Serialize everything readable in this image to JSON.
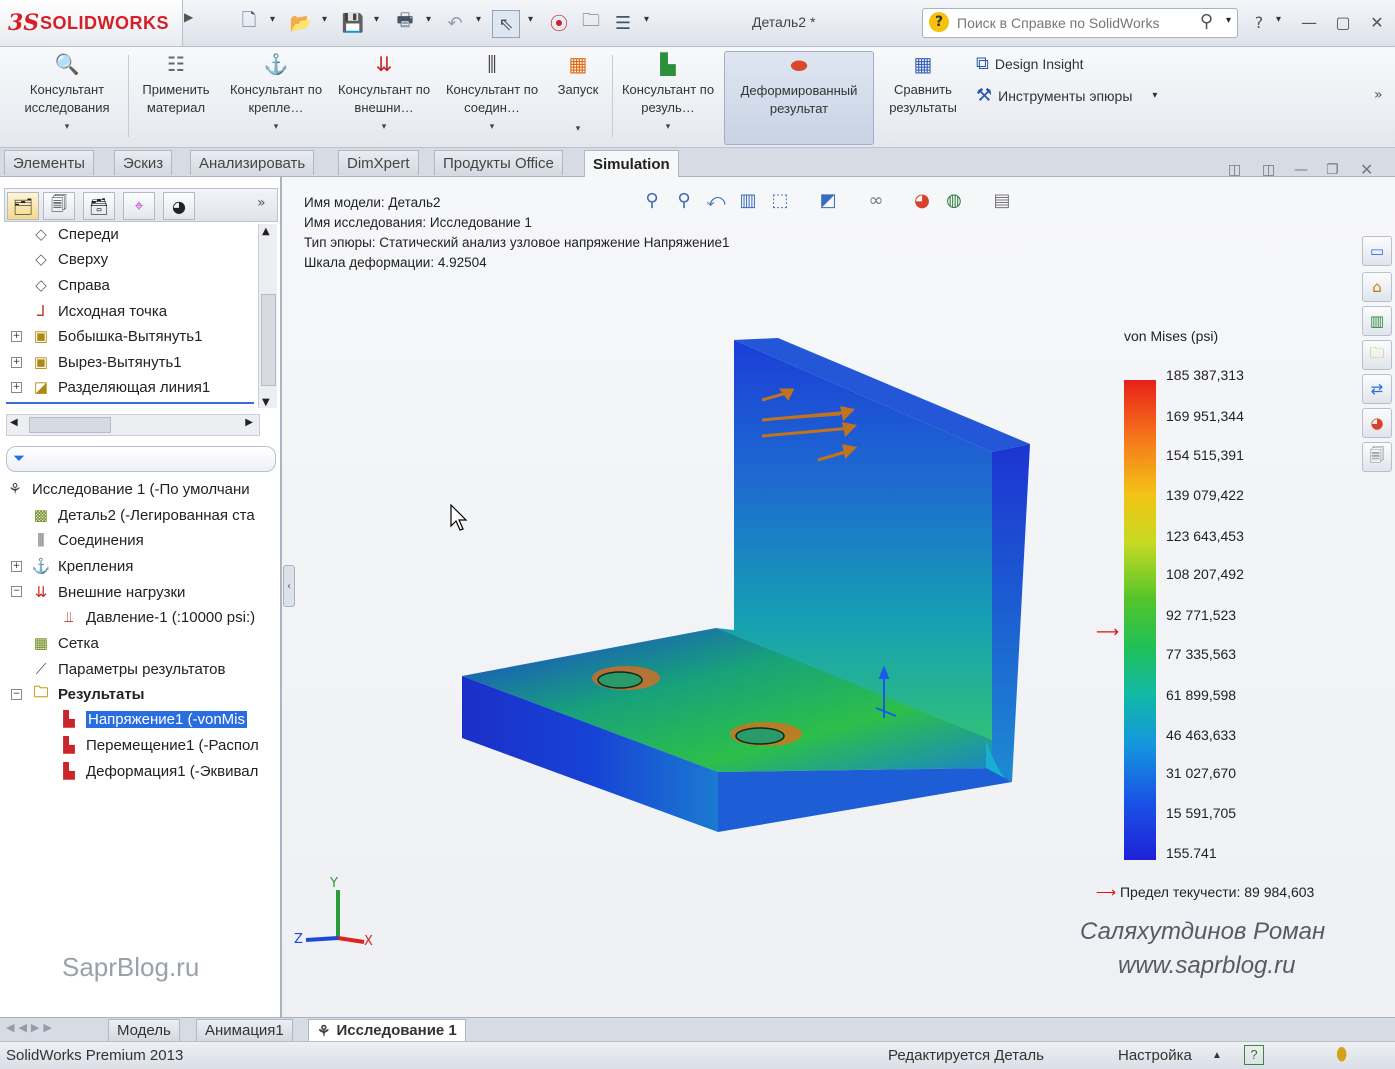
{
  "app": {
    "logo_ds": "3S",
    "logo_text": "SOLIDWORKS",
    "document_title": "Деталь2 *",
    "search_placeholder": "Поиск в Справке по SolidWorks"
  },
  "ribbon": {
    "buttons": [
      {
        "label": "Консультант исследования",
        "icon": "study-advisor-icon"
      },
      {
        "label": "Применить материал",
        "icon": "apply-material-icon"
      },
      {
        "label": "Консультант по крепле…",
        "icon": "fixtures-advisor-icon"
      },
      {
        "label": "Консультант по внешни…",
        "icon": "loads-advisor-icon"
      },
      {
        "label": "Консультант по соедин…",
        "icon": "connections-advisor-icon"
      },
      {
        "label": "Запуск",
        "icon": "run-icon"
      },
      {
        "label": "Консультант по резуль…",
        "icon": "results-advisor-icon"
      },
      {
        "label": "Деформированный результат",
        "icon": "deformed-result-icon"
      },
      {
        "label": "Сравнить результаты",
        "icon": "compare-results-icon"
      }
    ],
    "design_insight": "Design Insight",
    "plot_tools": "Инструменты эпюры"
  },
  "tabs": [
    "Элементы",
    "Эскиз",
    "Анализировать",
    "DimXpert",
    "Продукты Office",
    "Simulation"
  ],
  "feature_tree": [
    {
      "label": "Спереди",
      "icon": "plane-icon"
    },
    {
      "label": "Сверху",
      "icon": "plane-icon"
    },
    {
      "label": "Справа",
      "icon": "plane-icon"
    },
    {
      "label": "Исходная точка",
      "icon": "origin-icon"
    },
    {
      "label": "Бобышка-Вытянуть1",
      "icon": "extrude-boss-icon"
    },
    {
      "label": "Вырез-Вытянуть1",
      "icon": "extrude-cut-icon"
    },
    {
      "label": "Разделяющая линия1",
      "icon": "split-line-icon"
    }
  ],
  "study_tree": [
    {
      "label": "Исследование 1 (-По умолчани",
      "icon": "study-icon"
    },
    {
      "label": "Деталь2 (-Легированная ста",
      "icon": "part-icon"
    },
    {
      "label": "Соединения",
      "icon": "connections-icon"
    },
    {
      "label": "Крепления",
      "icon": "fixtures-icon"
    },
    {
      "label": "Внешние нагрузки",
      "icon": "external-loads-icon"
    },
    {
      "label": "Давление-1 (:10000 psi:)",
      "icon": "pressure-icon"
    },
    {
      "label": "Сетка",
      "icon": "mesh-icon"
    },
    {
      "label": "Параметры результатов",
      "icon": "result-options-icon"
    },
    {
      "label": "Результаты",
      "icon": "results-folder-icon"
    },
    {
      "label": "Напряжение1 (-vonMis",
      "icon": "stress-plot-icon"
    },
    {
      "label": "Перемещение1 (-Распол",
      "icon": "displacement-plot-icon"
    },
    {
      "label": "Деформация1 (-Эквивал",
      "icon": "strain-plot-icon"
    }
  ],
  "viewport": {
    "info": [
      "Имя модели: Деталь2",
      "Имя исследования: Исследование 1",
      "Тип эпюры: Статический анализ узловое напряжение Напряжение1",
      "Шкала деформации: 4.92504"
    ],
    "legend_title": "von Mises (psi)",
    "legend_ticks": [
      "185 387,313",
      "169 951,344",
      "154 515,391",
      "139 079,422",
      "123 643,453",
      "108 207,492",
      "92 771,523",
      "77 335,563",
      "61 899,598",
      "46 463,633",
      "31 027,670",
      "15 591,705",
      "155.741"
    ],
    "yield_label": "Предел текучести: 89 984,603",
    "author": "Саляхутдинов Роман",
    "site": "www.saprblog.ru",
    "watermark_left": "SaprBlog.ru",
    "axes": {
      "x": "X",
      "y": "Y",
      "z": "Z"
    }
  },
  "bottom_tabs": [
    "Модель",
    "Анимация1",
    "Исследование 1"
  ],
  "status": {
    "product": "SolidWorks Premium 2013",
    "editing": "Редактируется Деталь",
    "settings": "Настройка"
  },
  "colors": {
    "logo_red": "#d51f26",
    "selection_blue": "#2a6de0",
    "legend_max": "#e8201a",
    "legend_min": "#1e22d8"
  }
}
